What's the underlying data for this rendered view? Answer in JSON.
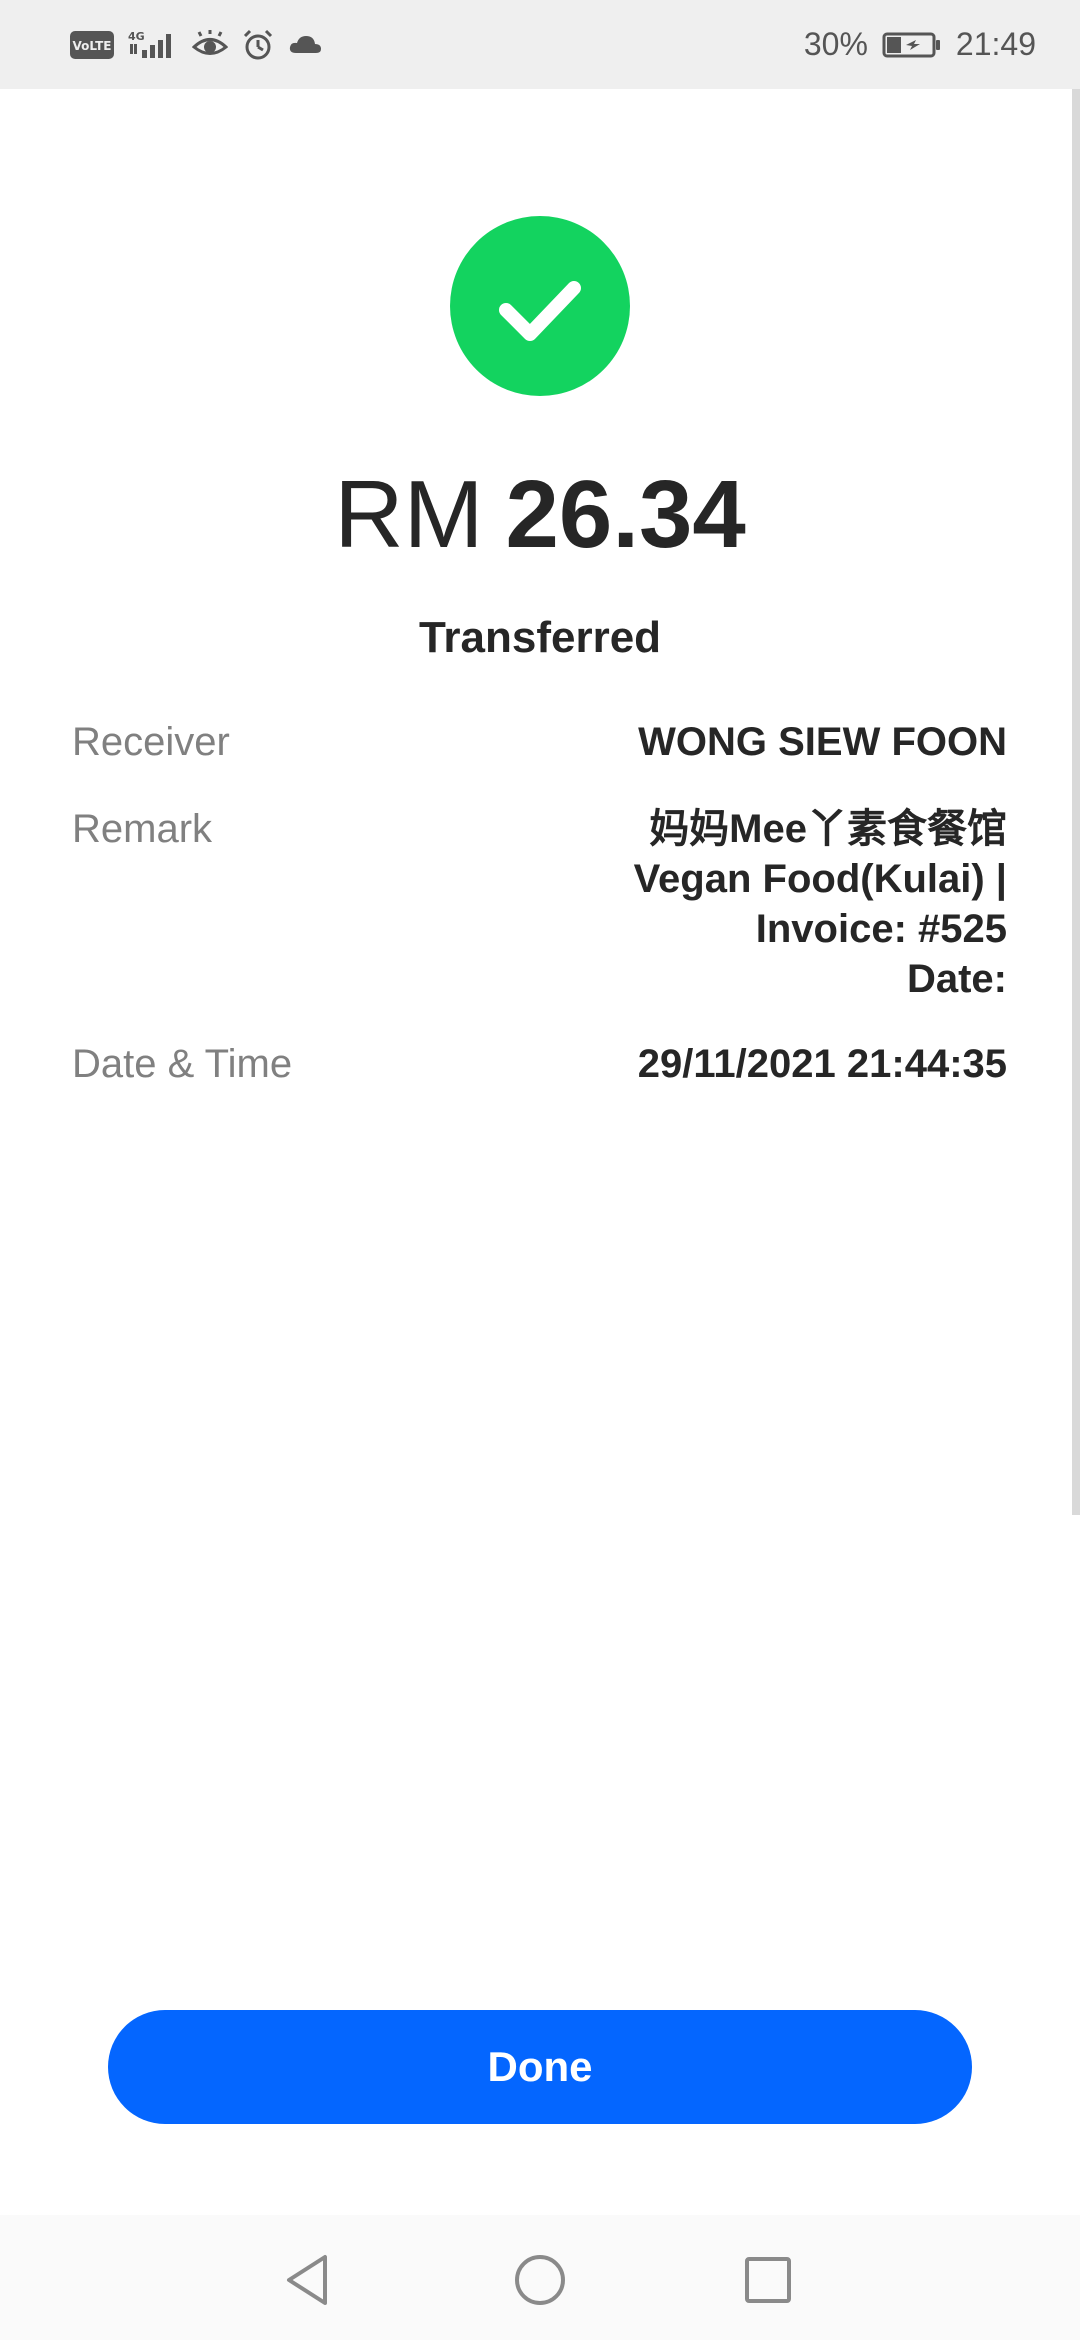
{
  "status_bar": {
    "battery_percent": "30%",
    "time": "21:49",
    "icons": [
      "volte-icon",
      "signal-4g-icon",
      "eye-icon",
      "alarm-icon",
      "cloud-icon",
      "battery-icon"
    ]
  },
  "result": {
    "currency": "RM",
    "amount": "26.34",
    "status": "Transferred",
    "status_icon": "checkmark-icon",
    "accent_color": "#13d35f"
  },
  "details": {
    "receiver": {
      "label": "Receiver",
      "value": "WONG SIEW FOON"
    },
    "remark": {
      "label": "Remark",
      "lines": [
        "妈妈Mee丫素食餐馆",
        "Vegan Food(Kulai) |",
        "Invoice: #525",
        "Date:"
      ]
    },
    "datetime": {
      "label": "Date & Time",
      "value": "29/11/2021 21:44:35"
    }
  },
  "actions": {
    "done_label": "Done",
    "button_color": "#0466ff"
  },
  "navigation": {
    "buttons": [
      "back-icon",
      "home-icon",
      "recents-icon"
    ]
  }
}
